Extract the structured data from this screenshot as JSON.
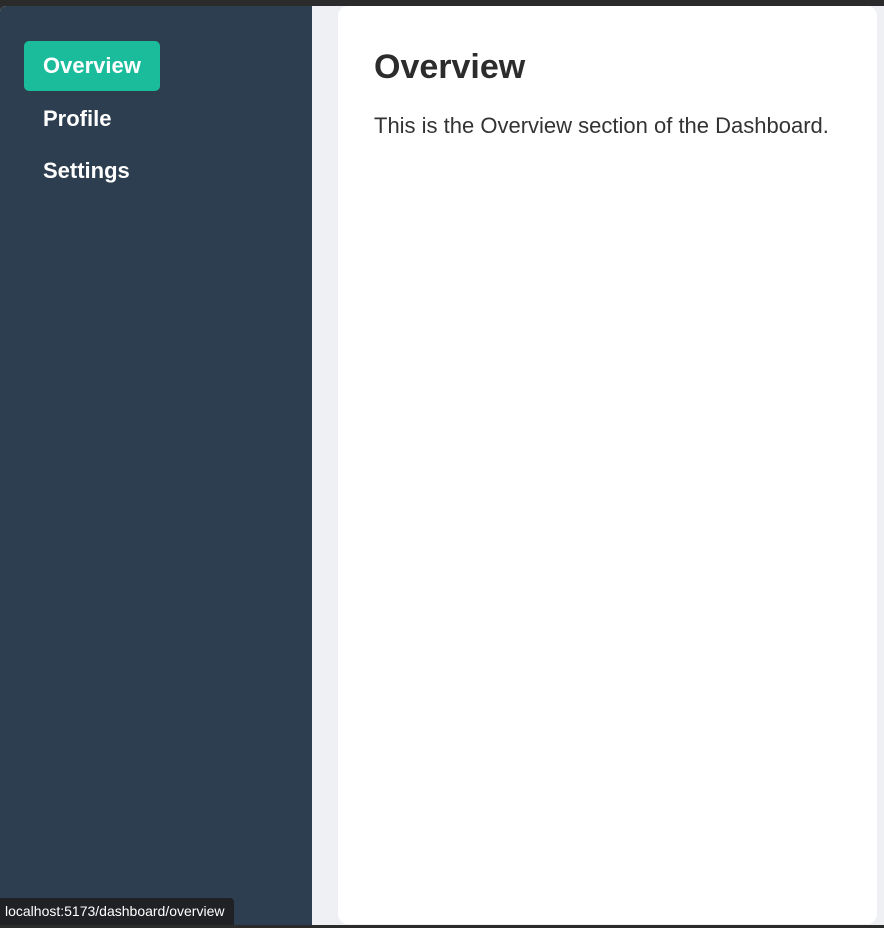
{
  "sidebar": {
    "items": [
      {
        "label": "Overview",
        "active": true
      },
      {
        "label": "Profile",
        "active": false
      },
      {
        "label": "Settings",
        "active": false
      }
    ]
  },
  "main": {
    "title": "Overview",
    "description": "This is the Overview section of the Dashboard."
  },
  "status_bar": {
    "url": "localhost:5173/dashboard/overview"
  },
  "colors": {
    "sidebar_bg": "#2d3e50",
    "accent": "#1abc9c",
    "content_bg": "#ffffff",
    "page_bg": "#eef0f4"
  }
}
